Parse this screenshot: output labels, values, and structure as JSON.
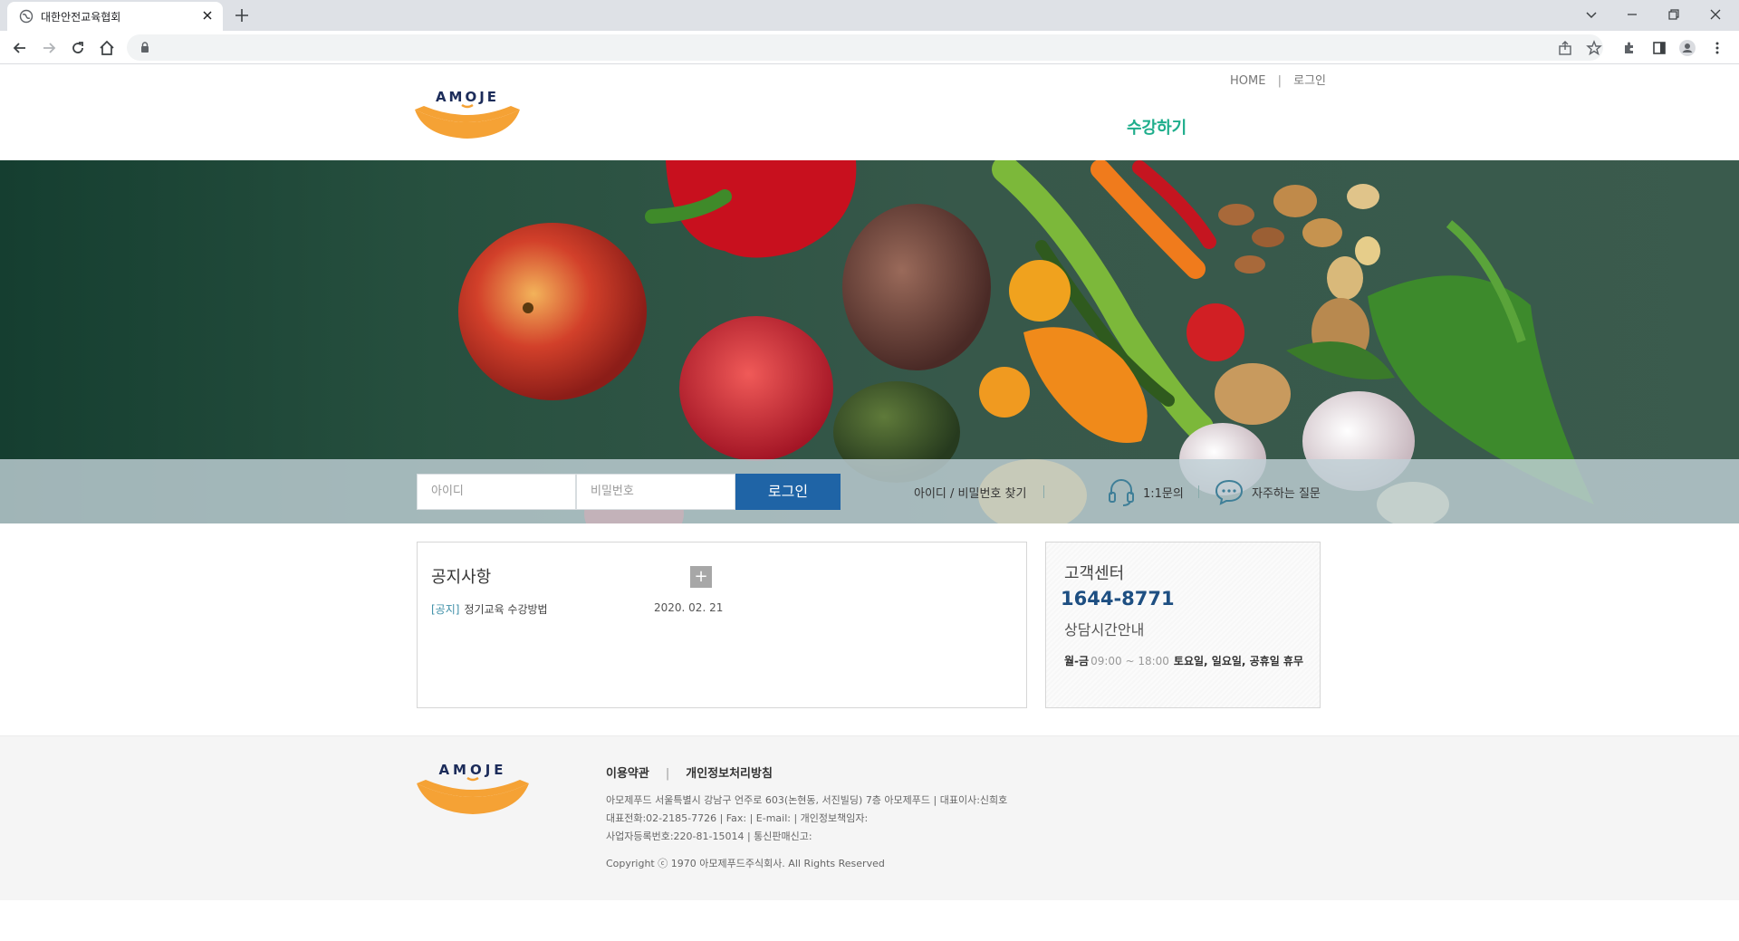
{
  "browser": {
    "tab_title": "대한안전교육협회"
  },
  "header": {
    "home_link": "HOME",
    "login_link": "로그인",
    "util_separator": "|",
    "nav_course": "수강하기",
    "logo_text": "AMOJE"
  },
  "login": {
    "id_placeholder": "아이디",
    "pw_placeholder": "비밀번호",
    "button": "로그인",
    "find_account": "아이디 / 비밀번호 찾기",
    "inquiry": "1:1문의",
    "faq": "자주하는 질문"
  },
  "notice": {
    "title": "공지사항",
    "more": "+",
    "items": [
      {
        "tag": "[공지]",
        "title": "정기교육 수강방법",
        "date": "2020. 02. 21"
      }
    ]
  },
  "customer_center": {
    "title": "고객센터",
    "phone": "1644-8771",
    "hours_title": "상담시간안내",
    "days": "월-금",
    "time": "09:00 ~ 18:00",
    "closed": "토요일, 일요일, 공휴일 휴무"
  },
  "footer": {
    "terms": "이용약관",
    "separator": "|",
    "privacy": "개인정보처리방침",
    "address": "아모제푸드 서울특별시 강남구 언주로 603(논현동, 서진빌딩) 7층 아모제푸드 | 대표이사:신희호",
    "contact": "대표전화:02-2185-7726 | Fax: | E-mail: | 개인정보책임자:",
    "business": "사업자등록번호:220-81-15014 | 통신판매신고:",
    "copyright": "Copyright ⓒ 1970 아모제푸드주식회사. All Rights Reserved"
  },
  "colors": {
    "accent_green": "#1fae8c",
    "login_blue": "#1f64a6",
    "logo_orange": "#f5a235",
    "logo_navy": "#1c2c5a"
  }
}
